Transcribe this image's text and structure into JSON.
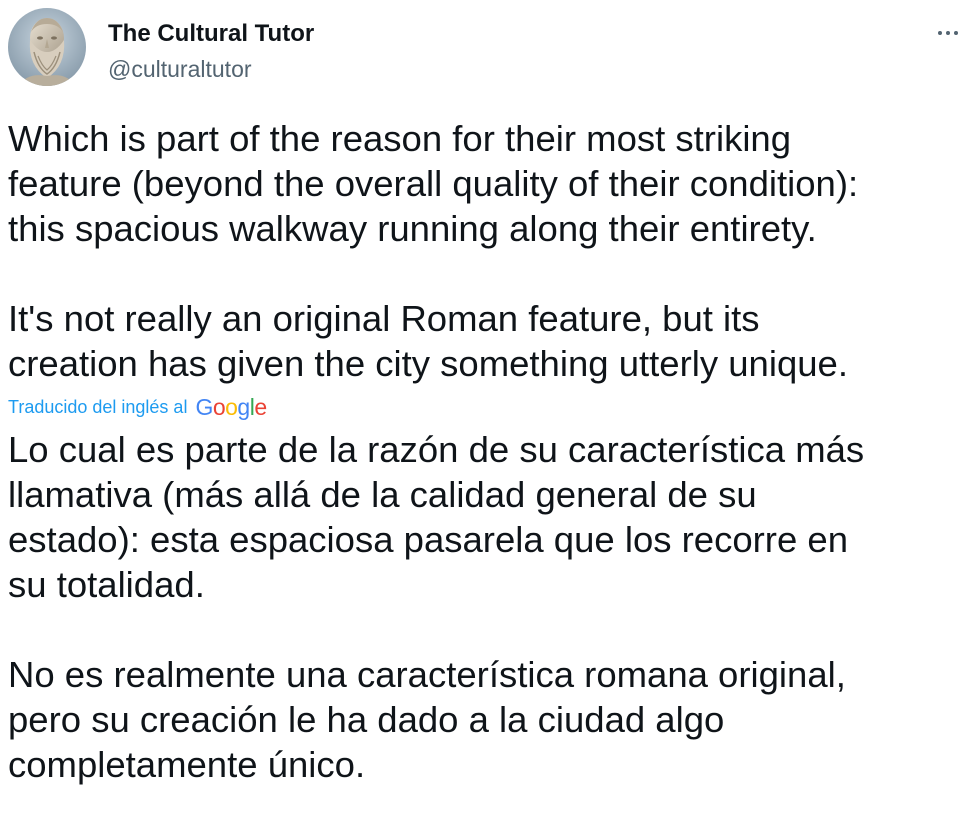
{
  "tweet": {
    "author": {
      "display_name": "The Cultural Tutor",
      "handle": "@culturaltutor"
    },
    "more_icon": "more-horizontal-icon",
    "original_paragraphs": [
      "Which is part of the reason for their most striking\nfeature (beyond the overall quality of their condition):\nthis spacious walkway running along their entirety.",
      "It's not really an original Roman feature, but its\ncreation has given the city something utterly unique."
    ],
    "translation_label": "Traducido del inglés al",
    "translation_provider": [
      "G",
      "o",
      "o",
      "g",
      "l",
      "e"
    ],
    "translated_paragraphs": [
      "Lo cual es parte de la razón de su característica más\nllamativa (más allá de la calidad general de su\nestado): esta espaciosa pasarela que los recorre en\nsu totalidad.",
      "No es realmente una característica romana original,\npero su creación le ha dado a la ciudad algo\ncompletamente único."
    ]
  },
  "colors": {
    "text_primary": "#0f1419",
    "text_secondary": "#536471",
    "link": "#1d9bf0"
  }
}
